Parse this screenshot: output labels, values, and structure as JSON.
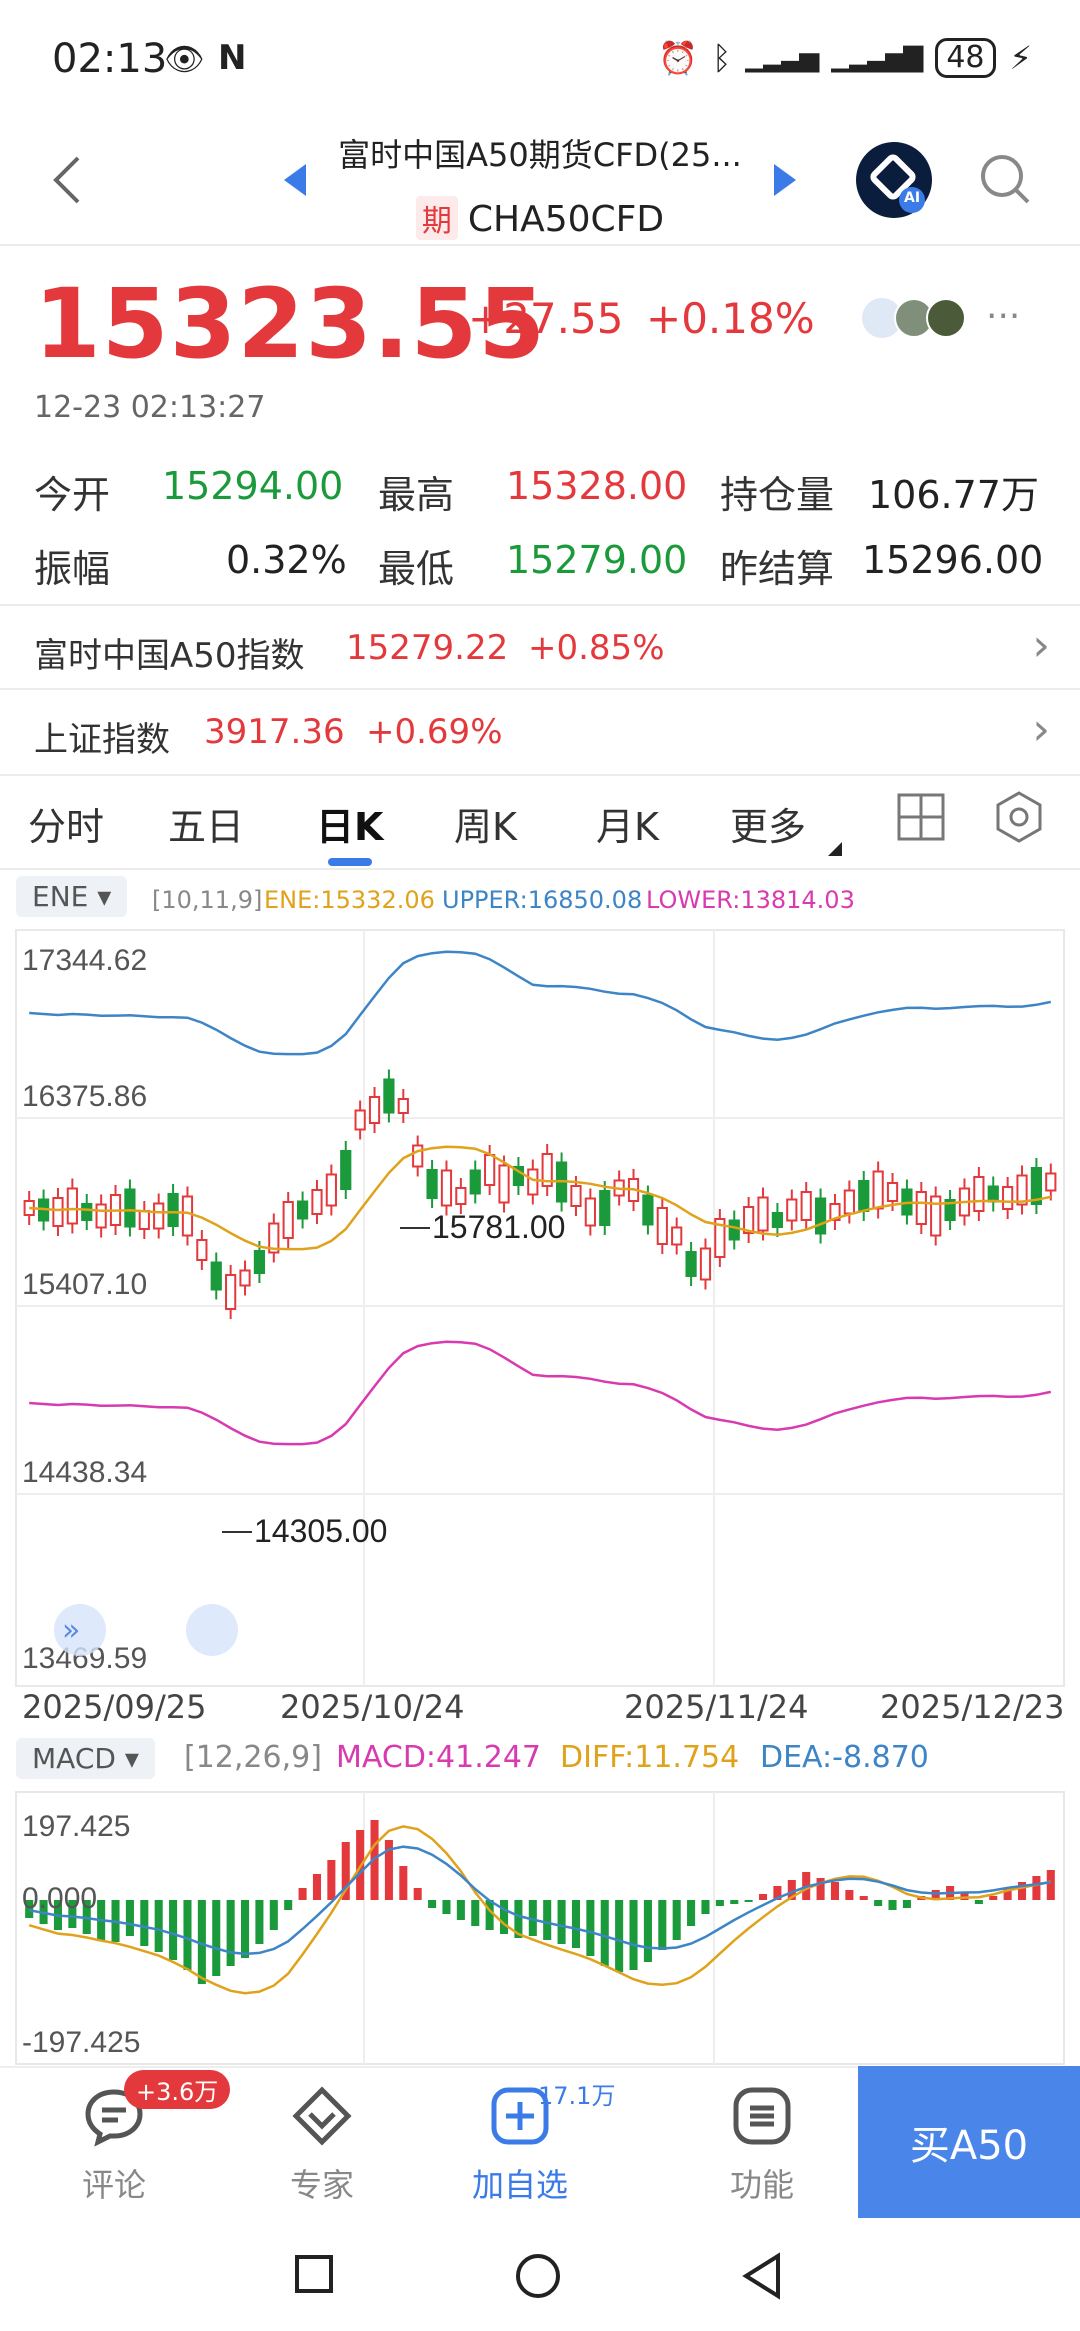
{
  "status_bar": {
    "time": "02:13",
    "battery": "48"
  },
  "header": {
    "title": "富时中国A50期货CFD(25...",
    "tag": "期",
    "symbol": "CHA50CFD",
    "ai_label": "AI"
  },
  "quote": {
    "price": "15323.55",
    "change": "+27.55",
    "change_pct": "+0.18%",
    "timestamp": "12-23 02:13:27"
  },
  "stats": {
    "open_label": "今开",
    "open": "15294.00",
    "high_label": "最高",
    "high": "15328.00",
    "oi_label": "持仓量",
    "oi": "106.77万",
    "amp_label": "振幅",
    "amp": "0.32%",
    "low_label": "最低",
    "low": "15279.00",
    "prev_label": "昨结算",
    "prev": "15296.00"
  },
  "related": [
    {
      "name": "富时中国A50指数",
      "value": "15279.22",
      "pct": "+0.85%"
    },
    {
      "name": "上证指数",
      "value": "3917.36",
      "pct": "+0.69%"
    }
  ],
  "tabs": [
    "分时",
    "五日",
    "日K",
    "周K",
    "月K",
    "更多"
  ],
  "kline": {
    "indicator": "ENE",
    "params": "[10,11,9]",
    "ene": "ENE:15332.06",
    "upper": "UPPER:16850.08",
    "lower": "LOWER:13814.03",
    "y_labels": [
      "17344.62",
      "16375.86",
      "15407.10",
      "14438.34",
      "13469.59"
    ],
    "high_mark": "15781.00",
    "low_mark": "14305.00",
    "dates": [
      "2025/09/25",
      "2025/10/24",
      "2025/11/24",
      "2025/12/23"
    ]
  },
  "macd": {
    "indicator": "MACD",
    "params": "[12,26,9]",
    "macd": "MACD:41.247",
    "diff": "DIFF:11.754",
    "dea": "DEA:-8.870",
    "y_labels": [
      "197.425",
      "0.000",
      "-197.425"
    ]
  },
  "bottom_nav": {
    "comment": "评论",
    "comment_badge": "+3.6万",
    "expert": "专家",
    "add": "加自选",
    "add_count": "17.1万",
    "func": "功能",
    "buy": "买A50"
  },
  "colors": {
    "up": "#e4393c",
    "down": "#1a9a3a",
    "accent": "#4a86ea",
    "ene": "#e0a21b",
    "upper": "#3d85c6",
    "lower": "#d83ab0"
  }
}
